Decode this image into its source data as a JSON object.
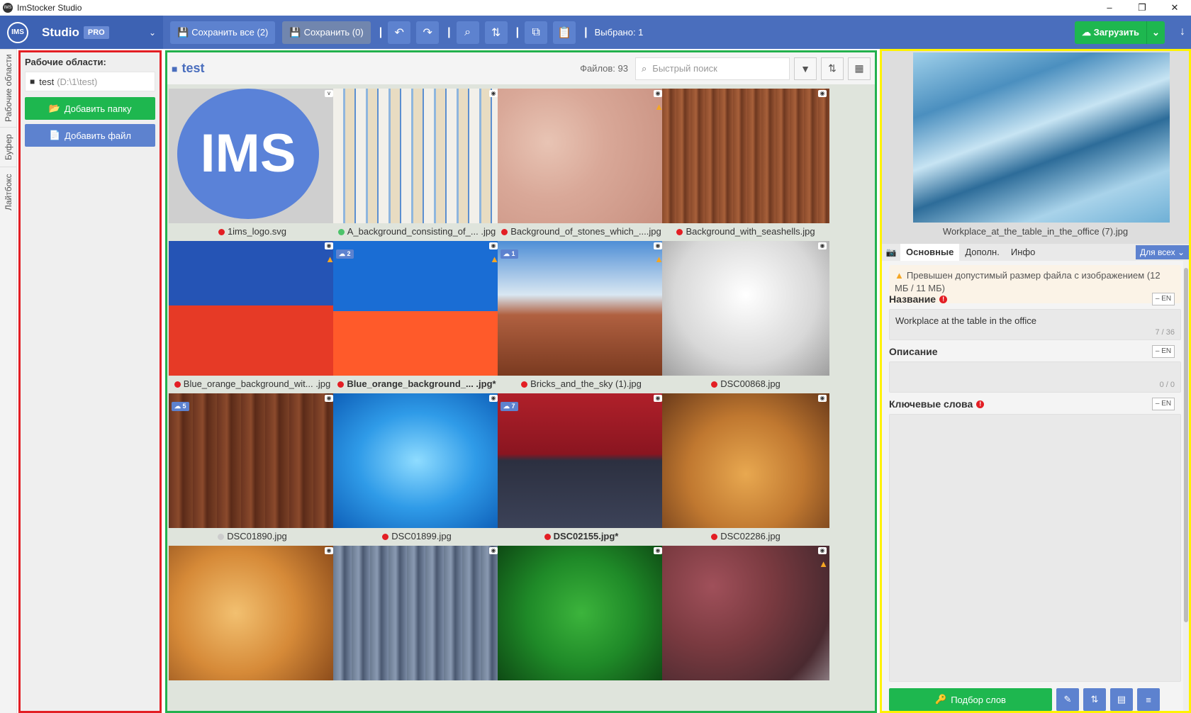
{
  "window": {
    "title": "ImStocker Studio",
    "controls": [
      "–",
      "❐",
      "✕"
    ]
  },
  "brand": {
    "logo": "IMS",
    "name": "Studio",
    "badge": "PRO"
  },
  "toolbar": {
    "save_all": "Сохранить все (2)",
    "save": "Сохранить (0)",
    "selected": "Выбрано: 1",
    "upload": "Загрузить"
  },
  "vtabs": [
    "Рабочие области",
    "Буфер",
    "Лайтбокс"
  ],
  "workspaces": {
    "header": "Рабочие области:",
    "items": [
      {
        "name": "test",
        "path": "(D:\\1\\test)"
      }
    ],
    "add_folder": "Добавить папку",
    "add_file": "Добавить файл"
  },
  "grid": {
    "folder": "test",
    "count": "Файлов: 93",
    "search_placeholder": "Быстрый поиск",
    "items": [
      {
        "name": "1ims_logo.svg",
        "status": "red",
        "bold": false
      },
      {
        "name": "A_background_consisting_of_... .jpg",
        "status": "green",
        "bold": false
      },
      {
        "name": "Background_of_stones_which_....jpg",
        "status": "red",
        "bold": false
      },
      {
        "name": "Background_with_seashells.jpg",
        "status": "red",
        "bold": false
      },
      {
        "name": "Blue_orange_background_wit... .jpg",
        "status": "red",
        "bold": false
      },
      {
        "name": "Blue_orange_background_... .jpg*",
        "status": "red",
        "bold": true,
        "cloud": "2"
      },
      {
        "name": "Bricks_and_the_sky (1).jpg",
        "status": "red",
        "bold": false,
        "cloud": "1"
      },
      {
        "name": "DSC00868.jpg",
        "status": "red",
        "bold": false
      },
      {
        "name": "DSC01890.jpg",
        "status": "gray",
        "bold": false,
        "cloud": "5"
      },
      {
        "name": "DSC01899.jpg",
        "status": "red",
        "bold": false
      },
      {
        "name": "DSC02155.jpg*",
        "status": "red",
        "bold": true,
        "cloud": "7"
      },
      {
        "name": "DSC02286.jpg",
        "status": "red",
        "bold": false
      },
      {
        "name": "",
        "status": "",
        "bold": false
      },
      {
        "name": "",
        "status": "",
        "bold": false
      },
      {
        "name": "",
        "status": "",
        "bold": false
      },
      {
        "name": "",
        "status": "",
        "bold": false
      }
    ]
  },
  "details": {
    "preview_name": "Workplace_at_the_table_in_the_office (7).jpg",
    "tabs": [
      "Основные",
      "Дополн.",
      "Инфо"
    ],
    "for_all": "Для всех",
    "warning": "Превышен допустимый размер файла с изображением (12 МБ / 11 МБ)",
    "title_label": "Название",
    "title_value": "Workplace at the table in the office",
    "title_count": "7 / 36",
    "desc_label": "Описание",
    "desc_count": "0 / 0",
    "keywords_label": "Ключевые слова",
    "lang": "EN",
    "keyword_btn": "Подбор слов"
  }
}
